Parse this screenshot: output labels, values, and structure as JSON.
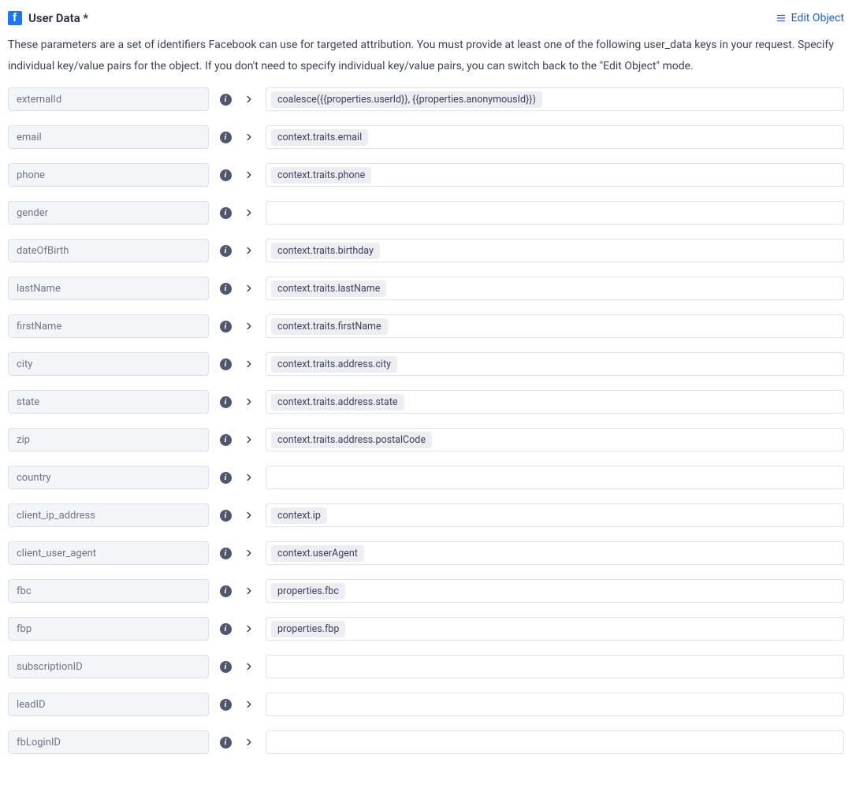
{
  "header": {
    "title": "User Data *",
    "editObject": "Edit Object"
  },
  "description": "These parameters are a set of identifiers Facebook can use for targeted attribution. You must provide at least one of the following user_data keys in your request. Specify individual key/value pairs for the object. If you don't need to specify individual key/value pairs, you can switch back to the \"Edit Object\" mode.",
  "rows": [
    {
      "key": "externalId",
      "value": "coalesce({{properties.userId}}, {{properties.anonymousId}})"
    },
    {
      "key": "email",
      "value": "context.traits.email"
    },
    {
      "key": "phone",
      "value": "context.traits.phone"
    },
    {
      "key": "gender",
      "value": ""
    },
    {
      "key": "dateOfBirth",
      "value": "context.traits.birthday"
    },
    {
      "key": "lastName",
      "value": "context.traits.lastName"
    },
    {
      "key": "firstName",
      "value": "context.traits.firstName"
    },
    {
      "key": "city",
      "value": "context.traits.address.city"
    },
    {
      "key": "state",
      "value": "context.traits.address.state"
    },
    {
      "key": "zip",
      "value": "context.traits.address.postalCode"
    },
    {
      "key": "country",
      "value": ""
    },
    {
      "key": "client_ip_address",
      "value": "context.ip"
    },
    {
      "key": "client_user_agent",
      "value": "context.userAgent"
    },
    {
      "key": "fbc",
      "value": "properties.fbc"
    },
    {
      "key": "fbp",
      "value": "properties.fbp"
    },
    {
      "key": "subscriptionID",
      "value": ""
    },
    {
      "key": "leadID",
      "value": ""
    },
    {
      "key": "fbLoginID",
      "value": ""
    }
  ]
}
